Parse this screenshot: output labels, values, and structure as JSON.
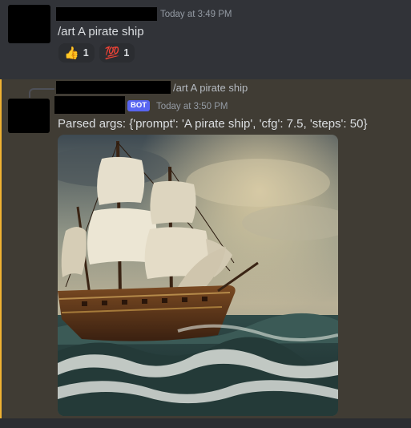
{
  "message1": {
    "timestamp": "Today at 3:49 PM",
    "content": "/art A pirate ship",
    "reactions": [
      {
        "emoji": "thumbs-up",
        "glyph": "👍",
        "count": "1"
      },
      {
        "emoji": "hundred-points",
        "glyph": "💯",
        "count": "1"
      }
    ]
  },
  "message2": {
    "reply_text": "/art A pirate ship",
    "badge": "BOT",
    "timestamp": "Today at 3:50 PM",
    "content": "Parsed args: {'prompt': 'A pirate ship', 'cfg': 7.5, 'steps': 50}",
    "highlight_color": "#f0b232"
  }
}
